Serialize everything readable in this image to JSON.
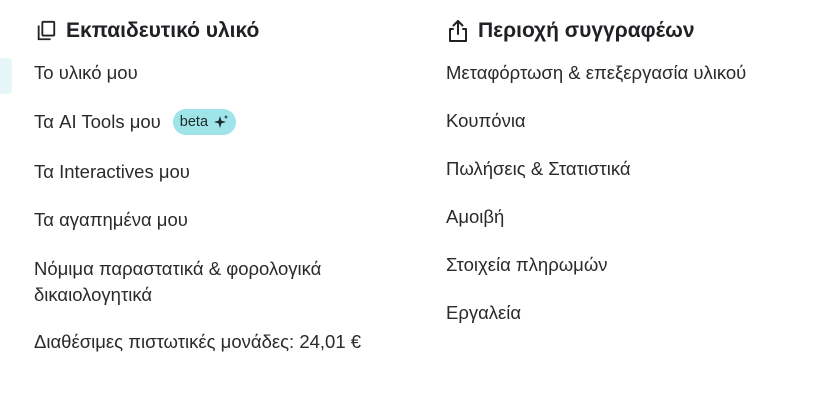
{
  "left_section": {
    "title": "Εκπαιδευτικό υλικό",
    "icon": "copy-icon",
    "items": [
      {
        "label": "Το υλικό μου"
      },
      {
        "label": "Τα AI Tools μου",
        "badge": "beta",
        "badge_icon": "sparkle-icon"
      },
      {
        "label": "Τα Interactives μου"
      },
      {
        "label": "Τα αγαπημένα μου"
      },
      {
        "label": "Νόμιμα παραστατικά & φορολογικά δικαιολογητικά"
      },
      {
        "label": "Διαθέσιμες πιστωτικές μονάδες: 24,01 €"
      }
    ]
  },
  "right_section": {
    "title": "Περιοχή συγγραφέων",
    "icon": "upload-share-icon",
    "items": [
      {
        "label": "Μεταφόρτωση & επεξεργασία υλικού"
      },
      {
        "label": "Κουπόνια"
      },
      {
        "label": "Πωλήσεις & Στατιστικά"
      },
      {
        "label": "Αμοιβή"
      },
      {
        "label": "Στοιχεία πληρωμών"
      },
      {
        "label": "Εργαλεία"
      }
    ]
  },
  "colors": {
    "badge_bg": "#9ee4e8",
    "edge_tab": "#e6f6f8",
    "text": "#202124"
  }
}
